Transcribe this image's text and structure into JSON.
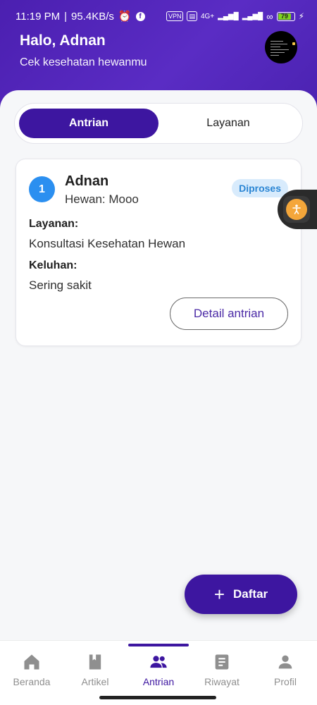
{
  "status_bar": {
    "time": "11:19 PM",
    "speed": "95.4KB/s",
    "vpn": "VPN",
    "network": "4G+",
    "battery": "79"
  },
  "header": {
    "greeting": "Halo, Adnan",
    "subtitle": "Cek kesehatan hewanmu"
  },
  "tabs": {
    "active": "Antrian",
    "inactive": "Layanan"
  },
  "queue_card": {
    "number": "1",
    "owner": "Adnan",
    "pet": "Hewan: Mooo",
    "status": "Diproses",
    "service_label": "Layanan:",
    "service_value": "Konsultasi Kesehatan Hewan",
    "complaint_label": "Keluhan:",
    "complaint_value": "Sering sakit",
    "detail_button": "Detail antrian"
  },
  "fab": {
    "label": "Daftar"
  },
  "bottom_nav": {
    "items": [
      {
        "label": "Beranda",
        "icon": "home-icon"
      },
      {
        "label": "Artikel",
        "icon": "book-icon"
      },
      {
        "label": "Antrian",
        "icon": "people-icon",
        "active": true
      },
      {
        "label": "Riwayat",
        "icon": "document-icon"
      },
      {
        "label": "Profil",
        "icon": "person-icon"
      }
    ]
  },
  "colors": {
    "primary": "#3d16a0",
    "header": "#4b1fb0",
    "badge_blue": "#2b8ff0",
    "status_badge_bg": "#d8ebfc",
    "accessibility": "#f4a63a"
  }
}
